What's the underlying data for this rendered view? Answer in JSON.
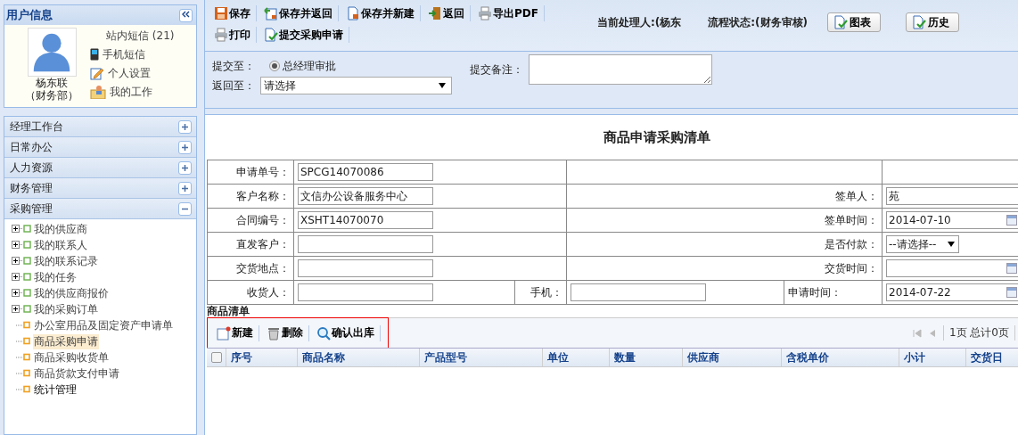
{
  "user_panel": {
    "title": "用户信息",
    "name": "杨东联",
    "dept": "（财务部）",
    "links": [
      {
        "label": "站内短信 (21)",
        "kind": "none"
      },
      {
        "label": "手机短信",
        "kind": "phone"
      },
      {
        "label": "个人设置",
        "kind": "pencil"
      },
      {
        "label": "我的工作",
        "kind": "work"
      }
    ]
  },
  "menu": [
    {
      "label": "经理工作台",
      "expanded": false
    },
    {
      "label": "日常办公",
      "expanded": false
    },
    {
      "label": "人力资源",
      "expanded": false
    },
    {
      "label": "财务管理",
      "expanded": false
    },
    {
      "label": "采购管理",
      "expanded": true,
      "children": [
        {
          "label": "我的供应商",
          "kind": "folder",
          "expanded": false,
          "selected": false
        },
        {
          "label": "我的联系人",
          "kind": "folder",
          "expanded": false,
          "selected": false
        },
        {
          "label": "我的联系记录",
          "kind": "folder",
          "expanded": false,
          "selected": false
        },
        {
          "label": "我的任务",
          "kind": "folder",
          "expanded": false,
          "selected": false
        },
        {
          "label": "我的供应商报价",
          "kind": "folder",
          "expanded": false,
          "selected": false
        },
        {
          "label": "我的采购订单",
          "kind": "folder",
          "expanded": false,
          "selected": false
        },
        {
          "label": "办公室用品及固定资产申请单",
          "kind": "page",
          "selected": false
        },
        {
          "label": "商品采购申请",
          "kind": "page",
          "selected": true
        },
        {
          "label": "商品采购收货单",
          "kind": "page",
          "selected": false
        },
        {
          "label": "商品货款支付申请",
          "kind": "page",
          "selected": false
        },
        {
          "label": "统计管理",
          "kind": "page",
          "selected": false
        }
      ]
    }
  ],
  "toolbar": [
    [
      {
        "label": "保存",
        "kind": "save"
      },
      {
        "label": "保存并返回",
        "kind": "save-return"
      },
      {
        "label": "保存并新建",
        "kind": "save-new"
      },
      {
        "label": "返回",
        "kind": "back"
      },
      {
        "label": "导出PDF",
        "kind": "print"
      }
    ],
    [
      {
        "label": "打印",
        "kind": "print"
      },
      {
        "label": "提交采购申请",
        "kind": "submit"
      }
    ]
  ],
  "status": {
    "handler": "当前处理人:(杨东",
    "flow": "流程状态:(财务审核)",
    "buttons": [
      "图表",
      "历史"
    ]
  },
  "submit_form": {
    "submit_label": "提交至：",
    "options": [
      {
        "label": "总经理审批",
        "selected": true
      }
    ],
    "return_label": "返回至：",
    "return_value": "请选择",
    "remark_label": "提交备注："
  },
  "form": {
    "title": "商品申请采购清单",
    "rows": [
      {
        "kind": "standard",
        "label": "申请单号：",
        "field": {
          "kind": "input",
          "value": "SPCG14070086"
        }
      },
      {
        "kind": "standard",
        "label": "客户名称：",
        "field": {
          "kind": "input",
          "value": "文信办公设备服务中心"
        },
        "right_label": "签单人：",
        "right_field": {
          "kind": "input",
          "value": "苑"
        }
      },
      {
        "kind": "standard",
        "label": "合同编号：",
        "field": {
          "kind": "input",
          "value": "XSHT14070070"
        },
        "right_label": "签单时间：",
        "right_field": {
          "kind": "date",
          "value": "2014-07-10"
        }
      },
      {
        "kind": "standard",
        "label": "直发客户：",
        "field": {
          "kind": "input"
        },
        "right_label": "是否付款：",
        "right_field": {
          "kind": "select",
          "value": "--请选择--"
        }
      },
      {
        "kind": "standard",
        "label": "交货地点：",
        "field": {
          "kind": "input"
        },
        "right_label": "交货时间：",
        "right_field": {
          "kind": "date"
        }
      },
      {
        "kind": "triple",
        "label": "收货人：",
        "field": {
          "kind": "input"
        },
        "mid_label": "手机：",
        "mid_field": {
          "kind": "input"
        },
        "right_label": "申请时间：",
        "right_field": {
          "kind": "date",
          "value": "2014-07-22"
        }
      }
    ]
  },
  "goods": {
    "title": "商品清单",
    "actions": [
      {
        "label": "新建",
        "kind": "new"
      },
      {
        "label": "删除",
        "kind": "delete"
      },
      {
        "label": "确认出库",
        "kind": "search"
      }
    ],
    "pager": "1页 总计0页",
    "select_all": {
      "checked": false
    },
    "columns": [
      "序号",
      "商品名称",
      "产品型号",
      "单位",
      "数量",
      "供应商",
      "含税单价",
      "小计",
      "交货日"
    ]
  }
}
